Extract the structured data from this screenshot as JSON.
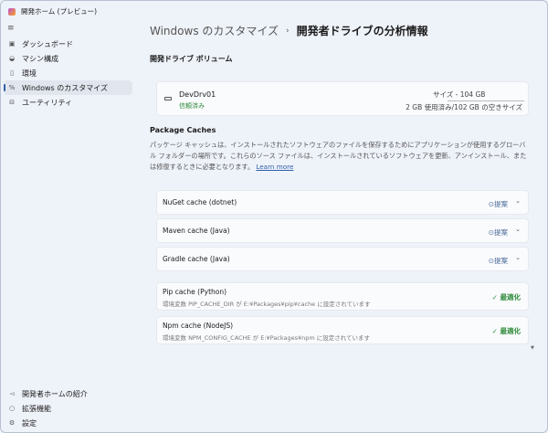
{
  "window": {
    "title": "開発ホーム (プレビュー)"
  },
  "sidebar": {
    "items": [
      {
        "label": "ダッシュボード",
        "icon": "dashboard-icon"
      },
      {
        "label": "マシン構成",
        "icon": "machine-config-icon"
      },
      {
        "label": "環境",
        "icon": "environment-icon"
      },
      {
        "label": "Windows のカスタマイズ",
        "icon": "customize-icon",
        "selected": true
      },
      {
        "label": "ユーティリティ",
        "icon": "utilities-icon"
      }
    ],
    "footer": [
      {
        "label": "開発者ホームの紹介",
        "icon": "megaphone-icon"
      },
      {
        "label": "拡張機能",
        "icon": "extensions-icon"
      },
      {
        "label": "設定",
        "icon": "gear-icon"
      }
    ]
  },
  "breadcrumb": {
    "parent": "Windows のカスタマイズ",
    "separator": "›",
    "current": "開発者ドライブの分析情報"
  },
  "volume_section": {
    "heading": "開発ドライブ ボリューム",
    "name": "DevDrv01",
    "status": "信頼済み",
    "size": "サイズ - 104 GB",
    "used": "2 GB 使用済み",
    "free": "102 GB の空きサイズ"
  },
  "caches": {
    "heading": "Package Caches",
    "description": "パッケージ キャッシュは、インストールされたソフトウェアのファイルを保存するためにアプリケーションが使用するグローバル フォルダーの場所です。これらのソース ファイルは、インストールされているソフトウェアを更新、アンインストール、または修復するときに必要となります。",
    "learn_more": "Learn more",
    "suggested": [
      {
        "name": "NuGet cache (dotnet)",
        "status": "提案"
      },
      {
        "name": "Maven cache (Java)",
        "status": "提案"
      },
      {
        "name": "Gradle cache (Java)",
        "status": "提案"
      }
    ],
    "optimized": [
      {
        "name": "Pip cache (Python)",
        "detail": "環境変数 PIP_CACHE_DIR が E:¥Packages¥pip¥cache に設定されています",
        "status": "最適化"
      },
      {
        "name": "Npm cache (NodeJS)",
        "detail": "環境変数 NPM_CONFIG_CACHE が E:¥Packages¥npm に設定されています",
        "status": "最適化"
      }
    ]
  }
}
